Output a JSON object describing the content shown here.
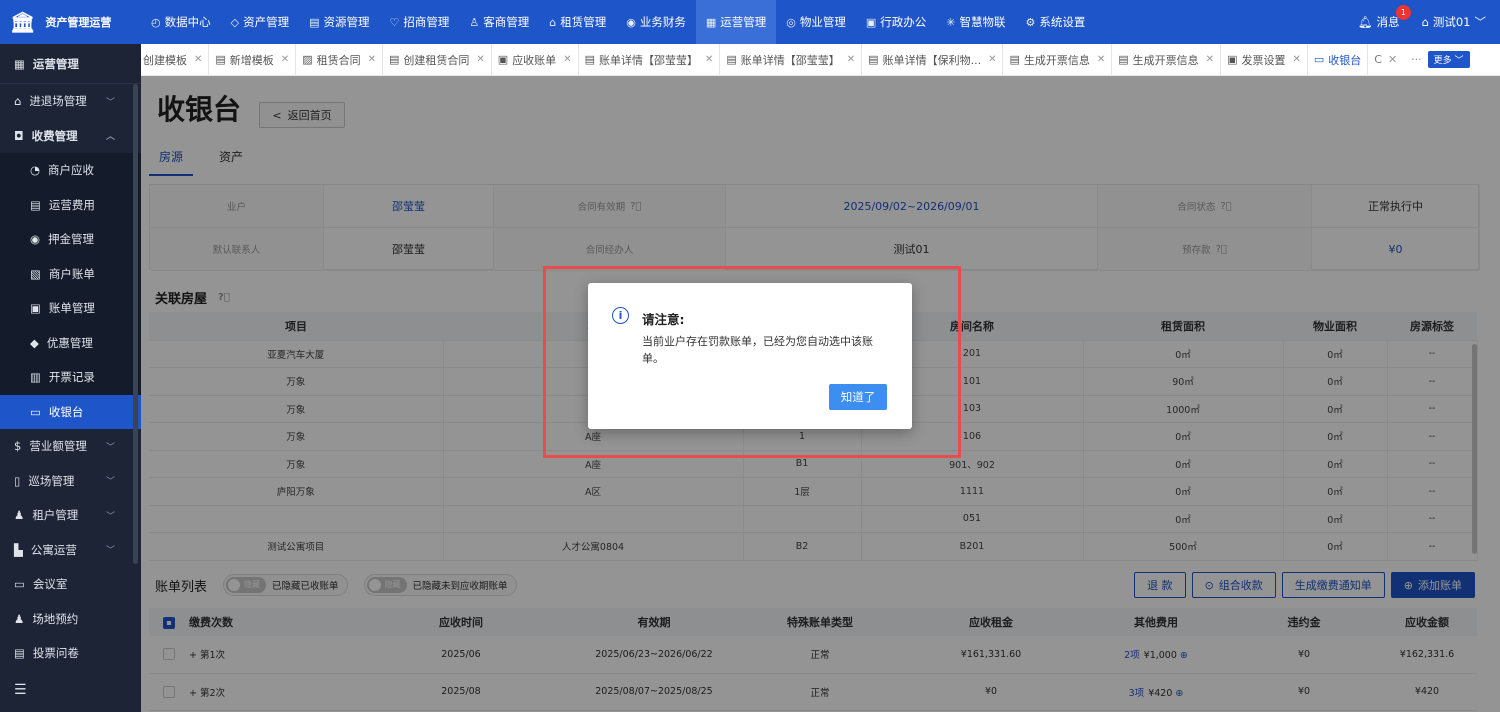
{
  "app": {
    "title": "资产管理运营"
  },
  "topnav": [
    {
      "icon": "◴",
      "label": "数据中心"
    },
    {
      "icon": "◇",
      "label": "资产管理"
    },
    {
      "icon": "▤",
      "label": "资源管理"
    },
    {
      "icon": "♡",
      "label": "招商管理"
    },
    {
      "icon": "♙",
      "label": "客商管理"
    },
    {
      "icon": "⌂",
      "label": "租赁管理"
    },
    {
      "icon": "◉",
      "label": "业务财务"
    },
    {
      "icon": "▦",
      "label": "运营管理"
    },
    {
      "icon": "◎",
      "label": "物业管理"
    },
    {
      "icon": "▣",
      "label": "行政办公"
    },
    {
      "icon": "✳",
      "label": "智慧物联"
    },
    {
      "icon": "⚙",
      "label": "系统设置"
    }
  ],
  "header": {
    "messages": "消息",
    "badge": "1",
    "user": "测试01"
  },
  "sidebar": {
    "head": "运营管理",
    "items": [
      {
        "icon": "⌂",
        "label": "进退场管理",
        "chev": "﹀",
        "bold": false
      },
      {
        "icon": "◘",
        "label": "收费管理",
        "chev": "︿",
        "bold": true
      },
      {
        "icon": "◔",
        "label": "商户应收",
        "sub": true
      },
      {
        "icon": "▤",
        "label": "运营费用",
        "sub": true
      },
      {
        "icon": "◉",
        "label": "押金管理",
        "sub": true
      },
      {
        "icon": "▧",
        "label": "商户账单",
        "sub": true
      },
      {
        "icon": "▣",
        "label": "账单管理",
        "sub": true
      },
      {
        "icon": "◆",
        "label": "优惠管理",
        "sub": true
      },
      {
        "icon": "▥",
        "label": "开票记录",
        "sub": true
      },
      {
        "icon": "▭",
        "label": "收银台",
        "sub": true,
        "active": true
      },
      {
        "icon": "$",
        "label": "营业额管理",
        "chev": "﹀"
      },
      {
        "icon": "▯",
        "label": "巡场管理",
        "chev": "﹀"
      },
      {
        "icon": "♟",
        "label": "租户管理",
        "chev": "﹀"
      },
      {
        "icon": "▙",
        "label": "公寓运营",
        "chev": "﹀"
      },
      {
        "icon": "▭",
        "label": "会议室"
      },
      {
        "icon": "♟",
        "label": "场地预约"
      },
      {
        "icon": "▤",
        "label": "投票问卷"
      }
    ],
    "collapse_icon": "☰"
  },
  "tabs": [
    {
      "icon": "",
      "label": "创建模板"
    },
    {
      "icon": "▤",
      "label": "新增模板"
    },
    {
      "icon": "▨",
      "label": "租赁合同"
    },
    {
      "icon": "▤",
      "label": "创建租赁合同"
    },
    {
      "icon": "▣",
      "label": "应收账单"
    },
    {
      "icon": "▤",
      "label": "账单详情【邵莹莹】"
    },
    {
      "icon": "▤",
      "label": "账单详情【邵莹莹】"
    },
    {
      "icon": "▤",
      "label": "账单详情【保利物..."
    },
    {
      "icon": "▤",
      "label": "生成开票信息"
    },
    {
      "icon": "▤",
      "label": "生成开票信息"
    },
    {
      "icon": "▣",
      "label": "发票设置"
    },
    {
      "icon": "▭",
      "label": "收银台",
      "active": true
    }
  ],
  "tabs_extra": {
    "refresh": "C",
    "dots": "···",
    "more": "更多 ﹀"
  },
  "page": {
    "title": "收银台",
    "back": "返回首页",
    "back_icon": "<"
  },
  "subtabs": [
    "房源",
    "资产"
  ],
  "info": [
    {
      "label": "业户",
      "value": "邵莹莹",
      "blue": true
    },
    {
      "label": "合同有效期",
      "q": true,
      "value": "2025/09/02~2026/09/01",
      "blue": true
    },
    {
      "label": "合同状态",
      "q": true,
      "value": "正常执行中"
    },
    {
      "label": "默认联系人",
      "value": "邵莹莹"
    },
    {
      "label": "合同经办人",
      "value": "测试01"
    },
    {
      "label": "预存款",
      "q": true,
      "value": "¥0",
      "blue": true
    }
  ],
  "rooms": {
    "title": "关联房屋",
    "headers": [
      "项目",
      "楼",
      "",
      "房间名称",
      "租赁面积",
      "物业面积",
      "房源标签"
    ],
    "rows": [
      [
        "亚夏汽车大厦",
        "",
        "",
        "201",
        "0㎡",
        "0㎡",
        "--"
      ],
      [
        "万象",
        "A",
        "",
        "101",
        "90㎡",
        "0㎡",
        "--"
      ],
      [
        "万象",
        "A",
        "",
        "103",
        "1000㎡",
        "0㎡",
        "--"
      ],
      [
        "万象",
        "A座",
        "1",
        "106",
        "0㎡",
        "0㎡",
        "--"
      ],
      [
        "万象",
        "A座",
        "B1",
        "901、902",
        "0㎡",
        "0㎡",
        "--"
      ],
      [
        "庐阳万象",
        "A区",
        "1层",
        "1111",
        "0㎡",
        "0㎡",
        "--"
      ],
      [
        "",
        "",
        "",
        "051",
        "0㎡",
        "0㎡",
        "--"
      ],
      [
        "测试公寓项目",
        "人才公寓0804",
        "B2",
        "B201",
        "500㎡",
        "0㎡",
        "--"
      ]
    ]
  },
  "bills": {
    "title": "账单列表",
    "toggle1": {
      "switch": "隐藏",
      "label": "已隐藏已收账单"
    },
    "toggle2": {
      "switch": "隐藏",
      "label": "已隐藏未到应收期账单"
    },
    "buttons": [
      "退 款",
      "组合收款",
      "生成缴费通知单",
      "添加账单"
    ],
    "headers": [
      "缴费次数",
      "应收时间",
      "有效期",
      "特殊账单类型",
      "应收租金",
      "其他费用",
      "违约金",
      "应收金额"
    ],
    "rows": [
      {
        "count": "第1次",
        "date": "2025/06",
        "period": "2025/06/23~2026/06/22",
        "type": "正常",
        "rent": "¥161,331.60",
        "other_items": "2项",
        "other_amt": "¥1,000",
        "penalty": "¥0",
        "total": "¥162,331.6"
      },
      {
        "count": "第2次",
        "date": "2025/08",
        "period": "2025/08/07~2025/08/25",
        "type": "正常",
        "rent": "¥0",
        "other_items": "3项",
        "other_amt": "¥420",
        "penalty": "¥0",
        "total": "¥420"
      }
    ]
  },
  "dialog": {
    "title": "请注意:",
    "message": "当前业户存在罚款账单，已经为您自动选中该账单。",
    "button": "知道了"
  }
}
